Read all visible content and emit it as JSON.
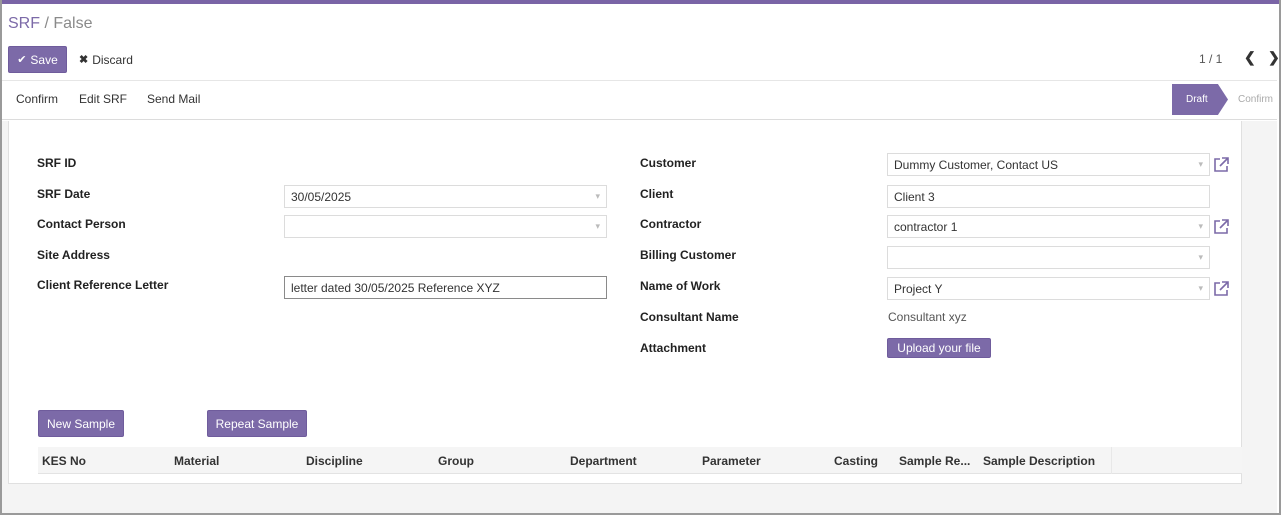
{
  "breadcrumb": {
    "parent": "SRF",
    "separator": " / ",
    "current": "False"
  },
  "toolbar": {
    "save_label": "Save",
    "discard_label": "Discard"
  },
  "pager": {
    "value": "1 / 1"
  },
  "actions": {
    "confirm": "Confirm",
    "edit_srf": "Edit SRF",
    "send_mail": "Send Mail"
  },
  "status": {
    "stages": [
      "Draft",
      "Confirm"
    ],
    "active": "Draft"
  },
  "form": {
    "left": {
      "srf_id": {
        "label": "SRF ID"
      },
      "srf_date": {
        "label": "SRF Date",
        "value": "30/05/2025"
      },
      "contact_person": {
        "label": "Contact Person",
        "value": ""
      },
      "site_address": {
        "label": "Site Address"
      },
      "client_reference_letter": {
        "label": "Client Reference Letter",
        "value": "letter dated 30/05/2025 Reference XYZ"
      }
    },
    "right": {
      "customer": {
        "label": "Customer",
        "value": "Dummy Customer, Contact US"
      },
      "client": {
        "label": "Client",
        "value": "Client 3"
      },
      "contractor": {
        "label": "Contractor",
        "value": "contractor 1"
      },
      "billing_customer": {
        "label": "Billing Customer",
        "value": ""
      },
      "name_of_work": {
        "label": "Name of Work",
        "value": "Project Y"
      },
      "consultant_name": {
        "label": "Consultant Name",
        "value": "Consultant xyz"
      },
      "attachment": {
        "label": "Attachment",
        "button": "Upload your file"
      }
    }
  },
  "samples": {
    "new_button": "New Sample",
    "repeat_button": "Repeat Sample",
    "columns": [
      "KES No",
      "Material",
      "Discipline",
      "Group",
      "Department",
      "Parameter",
      "Casting",
      "Sample Re...",
      "Sample Description"
    ]
  },
  "colors": {
    "accent": "#7c6aa8",
    "topbar": "#7a64a6"
  },
  "icons": {
    "save": "check-icon",
    "discard": "times-icon",
    "external": "external-link-icon",
    "prev": "chevron-left-icon",
    "next": "chevron-right-icon",
    "dropdown": "caret-down-icon"
  }
}
